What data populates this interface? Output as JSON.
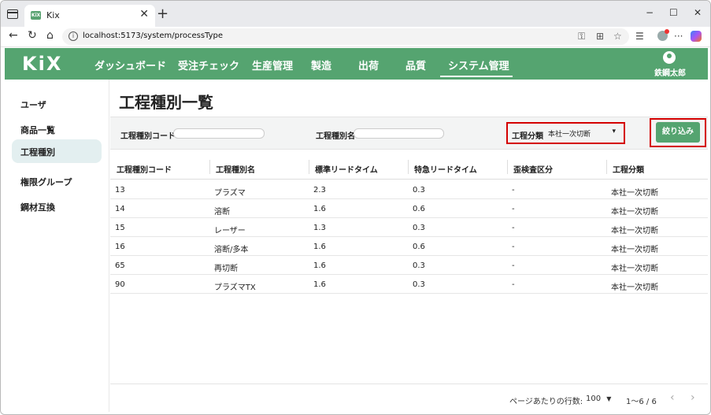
{
  "browser": {
    "tab_title": "Kix",
    "favicon_text": "KiX",
    "url": "localhost:5173/system/processType",
    "new_tab": "+",
    "tab_close": "✕",
    "win_min": "−",
    "win_max": "☐",
    "win_close": "✕"
  },
  "app": {
    "logo": "KiX",
    "menu": [
      "ダッシュボード",
      "受注チェック",
      "生産管理",
      "製造",
      "出荷",
      "品質",
      "システム管理"
    ],
    "active_menu": "システム管理",
    "user_name": "鉄鋼太郎",
    "brand_color": "#55a470"
  },
  "sidebar": {
    "items": [
      {
        "label": "ユーザ",
        "active": false
      },
      {
        "label": "商品一覧",
        "active": false
      },
      {
        "label": "工程種別",
        "active": true
      },
      {
        "label": "権限グループ",
        "active": false
      },
      {
        "label": "鋼材互換",
        "active": false
      }
    ]
  },
  "page": {
    "title": "工程種別一覧",
    "filters": {
      "code_label": "工程種別コード",
      "code_value": "",
      "name_label": "工程種別名",
      "name_value": "",
      "category_label": "工程分類",
      "category_value": "本社一次切断",
      "filter_button": "絞り込み"
    },
    "table": {
      "headers": [
        "工程種別コード",
        "工程種別名",
        "標準リードタイム",
        "特急リードタイム",
        "歪検査区分",
        "工程分類"
      ],
      "rows": [
        [
          "13",
          "プラズマ",
          "2.3",
          "0.3",
          "-",
          "本社一次切断"
        ],
        [
          "14",
          "溶断",
          "1.6",
          "0.6",
          "-",
          "本社一次切断"
        ],
        [
          "15",
          "レーザー",
          "1.3",
          "0.3",
          "-",
          "本社一次切断"
        ],
        [
          "16",
          "溶断/多本",
          "1.6",
          "0.6",
          "-",
          "本社一次切断"
        ],
        [
          "65",
          "再切断",
          "1.6",
          "0.3",
          "-",
          "本社一次切断"
        ],
        [
          "90",
          "プラズマTX",
          "1.6",
          "0.3",
          "-",
          "本社一次切断"
        ]
      ]
    },
    "pagination": {
      "rows_per_page_label": "ページあたりの行数:",
      "rows_per_page_value": "100",
      "range": "1〜6 / 6"
    }
  }
}
